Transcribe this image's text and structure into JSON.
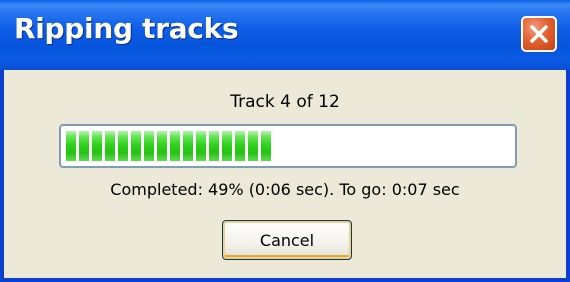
{
  "window": {
    "title": "Ripping tracks",
    "close_icon": "close-x-icon"
  },
  "dialog": {
    "track_label": "Track 4 of 12",
    "progress_fraction": 0.49,
    "status_text": "Completed: 49% (0:06 sec). To go: 0:07 sec",
    "cancel_label": "Cancel"
  },
  "colors": {
    "titlebar": "#0a5ae3",
    "progress": "#2bcf1a",
    "window_bg": "#ece9d8"
  }
}
